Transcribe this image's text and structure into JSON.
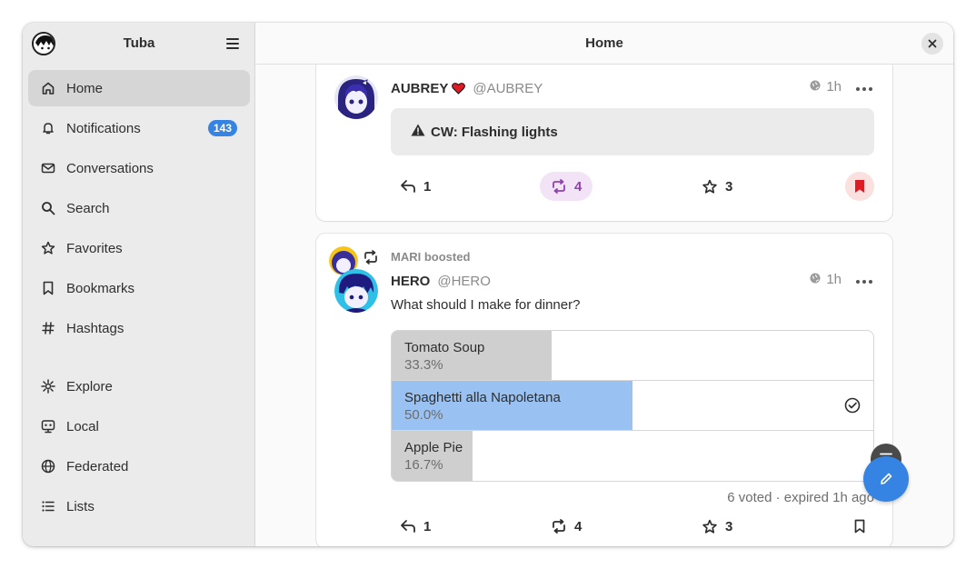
{
  "sidebar": {
    "app_title": "Tuba",
    "items": [
      {
        "label": "Home",
        "icon": "home-icon"
      },
      {
        "label": "Notifications",
        "icon": "bell-icon",
        "badge": "143"
      },
      {
        "label": "Conversations",
        "icon": "mail-icon"
      },
      {
        "label": "Search",
        "icon": "search-icon"
      },
      {
        "label": "Favorites",
        "icon": "star-icon"
      },
      {
        "label": "Bookmarks",
        "icon": "bookmark-icon"
      },
      {
        "label": "Hashtags",
        "icon": "hashtag-icon"
      },
      {
        "label": "Explore",
        "icon": "explore-icon"
      },
      {
        "label": "Local",
        "icon": "local-icon"
      },
      {
        "label": "Federated",
        "icon": "globe-icon"
      },
      {
        "label": "Lists",
        "icon": "list-icon"
      }
    ]
  },
  "header": {
    "title": "Home"
  },
  "posts": [
    {
      "display_name": "AUBREY",
      "handle": "@AUBREY",
      "time": "1h",
      "cw": "CW: Flashing lights",
      "replies": "1",
      "boosts": "4",
      "favorites": "3"
    },
    {
      "boosted_by": "MARI boosted",
      "display_name": "HERO",
      "handle": "@HERO",
      "time": "1h",
      "text": "What should I make for dinner?",
      "poll": {
        "options": [
          {
            "title": "Tomato Soup",
            "percent": "33.3%",
            "fraction": 0.333
          },
          {
            "title": "Spaghetti alla Napoletana",
            "percent": "50.0%",
            "fraction": 0.5
          },
          {
            "title": "Apple Pie",
            "percent": "16.7%",
            "fraction": 0.167
          }
        ],
        "info": "6 voted · expired 1h ago"
      },
      "replies": "1",
      "boosts": "4",
      "favorites": "3"
    }
  ],
  "colors": {
    "accent": "#3584e4",
    "boost": "#9141ac",
    "bookmark": "#e01b24",
    "poll_chosen": "#99c1f1"
  }
}
